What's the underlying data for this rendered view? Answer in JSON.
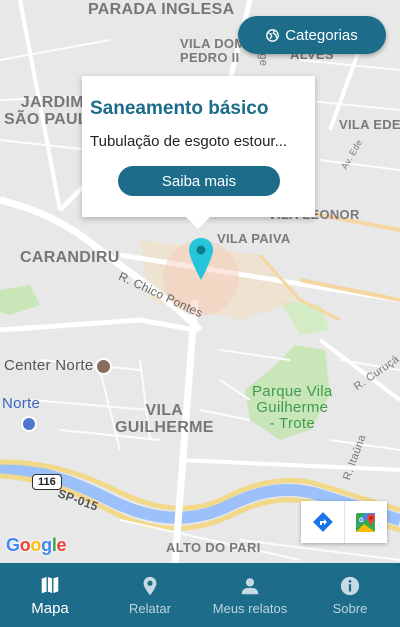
{
  "map": {
    "labels": {
      "parada_inglesa": "PARADA INGLESA",
      "vila_dom_pedro": "VILA DOM\nPEDRO II",
      "alves": "ALVES",
      "jardim_sao_paulo": "JARDIM\nSÃO PAULO",
      "vila_ede": "VILA EDE",
      "av_ede": "Av. Ede",
      "vila_leonor": "VILA LEONOR",
      "carandiru": "CARANDIRU",
      "vila_paiva": "VILA PAIVA",
      "r_chico_pontes": "R. Chico Pontes",
      "center_norte": "Center Norte",
      "norte": "Norte",
      "parque_vila_guilherme": "Parque Vila\nGuilherme\n- Trote",
      "vila_guilherme": "VILA\nGUILHERME",
      "r_curuca": "R. Curuçá",
      "r_itauna": "R. Itaúna",
      "sp_015": "SP-015",
      "shield_116": "116",
      "alto_do_pari": "ALTO DO PARI",
      "rge": "rge"
    },
    "google_logo": [
      "G",
      "o",
      "o",
      "g",
      "l",
      "e"
    ]
  },
  "categorias_button": {
    "label": "Categorias",
    "icon": "globe-icon"
  },
  "popup": {
    "title": "Saneamento básico",
    "text": "Tubulação de esgoto estour...",
    "button_label": "Saiba mais"
  },
  "bottom_nav": {
    "items": [
      {
        "label": "Mapa",
        "icon": "map-icon",
        "active": true
      },
      {
        "label": "Relatar",
        "icon": "location-pin-icon",
        "active": false
      },
      {
        "label": "Meus relatos",
        "icon": "person-icon",
        "active": false
      },
      {
        "label": "Sobre",
        "icon": "info-icon",
        "active": false
      }
    ]
  },
  "colors": {
    "primary": "#1c6c8a",
    "marker": "#26c6da",
    "park": "#c8e6b8"
  }
}
